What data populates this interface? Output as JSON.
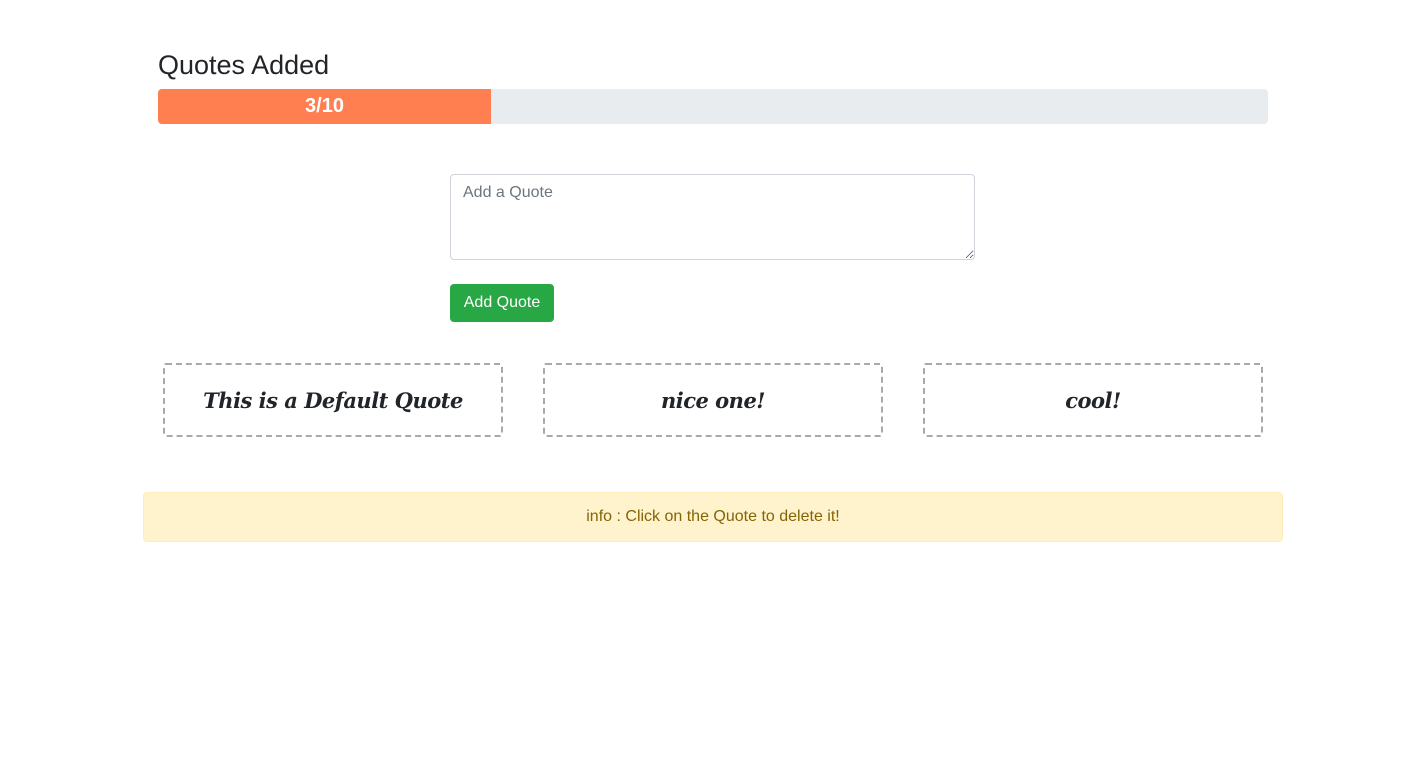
{
  "header": {
    "title": "Quotes Added"
  },
  "progress": {
    "label": "3/10",
    "current": 3,
    "max": 10,
    "fraction": 0.3,
    "color": "#ff7f50"
  },
  "form": {
    "placeholder": "Add a Quote",
    "value": "",
    "button_label": "Add Quote",
    "button_color": "#28a745"
  },
  "quotes": [
    {
      "text": "This is a Default Quote"
    },
    {
      "text": "nice one!"
    },
    {
      "text": "cool!"
    }
  ],
  "info": {
    "text": "info : Click on the Quote to delete it!",
    "color": "#856404",
    "background": "#fff3cd"
  }
}
